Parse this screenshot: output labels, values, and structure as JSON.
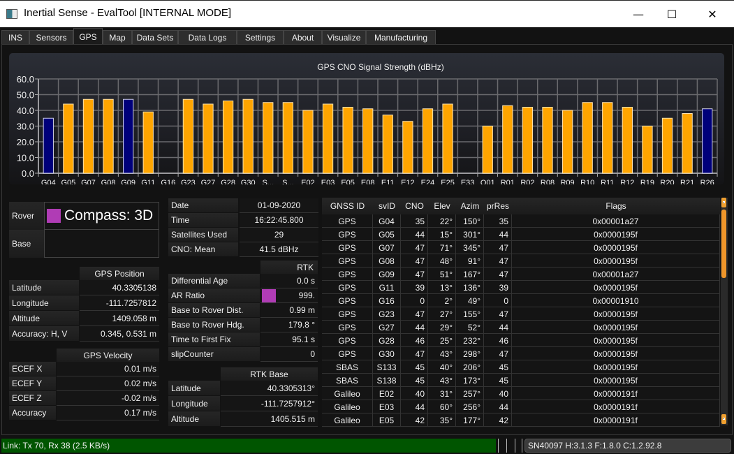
{
  "window": {
    "title": "Inertial Sense - EvalTool [INTERNAL MODE]",
    "minimize_glyph": "—",
    "maximize_glyph": "☐",
    "close_glyph": "✕"
  },
  "tabs": [
    "INS",
    "Sensors",
    "GPS",
    "Map",
    "Data Sets",
    "Data Logs",
    "Settings",
    "About",
    "Visualize",
    "Manufacturing"
  ],
  "active_tab": "GPS",
  "chart_data": {
    "type": "bar",
    "title": "GPS CNO Signal Strength (dBHz)",
    "xlabel": "",
    "ylabel": "",
    "ylim": [
      0,
      60
    ],
    "yticks": [
      "0.0",
      "10.0",
      "20.0",
      "30.0",
      "40.0",
      "50.0",
      "60.0"
    ],
    "grid": true,
    "categories": [
      "G04",
      "G05",
      "G07",
      "G08",
      "G09",
      "G11",
      "G16",
      "G23",
      "G27",
      "G28",
      "G30",
      "S...",
      "S...",
      "E02",
      "E03",
      "E05",
      "E08",
      "E11",
      "E12",
      "E24",
      "E25",
      "E33",
      "Q01",
      "R01",
      "R02",
      "R08",
      "R09",
      "R10",
      "R11",
      "R12",
      "R19",
      "R20",
      "R21",
      "R26"
    ],
    "values": [
      35,
      44,
      47,
      47,
      47,
      39,
      0,
      47,
      44,
      46,
      47,
      45,
      45,
      40,
      44,
      42,
      41,
      37,
      33,
      41,
      44,
      0,
      30,
      43,
      42,
      42,
      40,
      45,
      45,
      42,
      30,
      35,
      38,
      41
    ],
    "highlighted": [
      true,
      false,
      false,
      false,
      true,
      false,
      false,
      false,
      false,
      false,
      false,
      false,
      false,
      false,
      false,
      false,
      false,
      false,
      false,
      false,
      false,
      false,
      false,
      false,
      false,
      false,
      false,
      false,
      false,
      false,
      false,
      false,
      false,
      true
    ],
    "colors": {
      "normal": "#ffa500",
      "highlight": "#00007a"
    }
  },
  "fix": {
    "rover_label": "Rover",
    "rover_value": "Compass: 3D",
    "rover_color": "#b03cb5",
    "base_label": "Base",
    "base_value": ""
  },
  "gps_position": {
    "header": "GPS Position",
    "rows": [
      {
        "label": "Latitude",
        "value": "40.3305138"
      },
      {
        "label": "Longitude",
        "value": "-111.7257812"
      },
      {
        "label": "Altitude",
        "value": "1409.058 m"
      },
      {
        "label": "Accuracy: H, V",
        "value": "0.345, 0.531 m"
      }
    ]
  },
  "gps_velocity": {
    "header": "GPS Velocity",
    "rows": [
      {
        "label": "ECEF X",
        "value": "0.01 m/s"
      },
      {
        "label": "ECEF Y",
        "value": "0.02 m/s"
      },
      {
        "label": "ECEF Z",
        "value": "-0.02 m/s"
      },
      {
        "label": "Accuracy",
        "value": "0.17 m/s"
      }
    ]
  },
  "info": {
    "rows": [
      {
        "label": "Date",
        "value": "01-09-2020"
      },
      {
        "label": "Time",
        "value": "16:22:45.800"
      },
      {
        "label": "Satellites Used",
        "value": "29"
      },
      {
        "label": "CNO: Mean",
        "value": "41.5 dBHz"
      }
    ]
  },
  "rtk": {
    "header": "RTK",
    "ar_color": "#b03cb5",
    "rows": [
      {
        "label": "Differential Age",
        "value": "0.0 s"
      },
      {
        "label": "AR Ratio",
        "value": "999."
      },
      {
        "label": "Base to Rover Dist.",
        "value": "0.99 m"
      },
      {
        "label": "Base to Rover Hdg.",
        "value": "179.8 °"
      },
      {
        "label": "Time to First Fix",
        "value": "95.1 s"
      },
      {
        "label": "slipCounter",
        "value": "0"
      }
    ]
  },
  "rtk_base": {
    "header": "RTK Base",
    "rows": [
      {
        "label": "Latitude",
        "value": "40.3305313°"
      },
      {
        "label": "Longitude",
        "value": "-111.7257912°"
      },
      {
        "label": "Altitude",
        "value": "1405.515 m"
      }
    ]
  },
  "satellites": {
    "columns": [
      "GNSS ID",
      "svID",
      "CNO",
      "Elev",
      "Azim",
      "prRes",
      "Flags"
    ],
    "rows": [
      [
        "GPS",
        "G04",
        "35",
        "22°",
        "150°",
        "35",
        "0x00001a27"
      ],
      [
        "GPS",
        "G05",
        "44",
        "15°",
        "301°",
        "44",
        "0x0000195f"
      ],
      [
        "GPS",
        "G07",
        "47",
        "71°",
        "345°",
        "47",
        "0x0000195f"
      ],
      [
        "GPS",
        "G08",
        "47",
        "48°",
        "91°",
        "47",
        "0x0000195f"
      ],
      [
        "GPS",
        "G09",
        "47",
        "51°",
        "167°",
        "47",
        "0x00001a27"
      ],
      [
        "GPS",
        "G11",
        "39",
        "13°",
        "136°",
        "39",
        "0x0000195f"
      ],
      [
        "GPS",
        "G16",
        "0",
        "2°",
        "49°",
        "0",
        "0x00001910"
      ],
      [
        "GPS",
        "G23",
        "47",
        "27°",
        "155°",
        "47",
        "0x0000195f"
      ],
      [
        "GPS",
        "G27",
        "44",
        "29°",
        "52°",
        "44",
        "0x0000195f"
      ],
      [
        "GPS",
        "G28",
        "46",
        "25°",
        "232°",
        "46",
        "0x0000195f"
      ],
      [
        "GPS",
        "G30",
        "47",
        "43°",
        "298°",
        "47",
        "0x0000195f"
      ],
      [
        "SBAS",
        "S133",
        "45",
        "40°",
        "206°",
        "45",
        "0x0000195f"
      ],
      [
        "SBAS",
        "S138",
        "45",
        "43°",
        "173°",
        "45",
        "0x0000195f"
      ],
      [
        "Galileo",
        "E02",
        "40",
        "31°",
        "257°",
        "40",
        "0x0000191f"
      ],
      [
        "Galileo",
        "E03",
        "44",
        "60°",
        "256°",
        "44",
        "0x0000191f"
      ],
      [
        "Galileo",
        "E05",
        "42",
        "35°",
        "177°",
        "42",
        "0x0000191f"
      ]
    ]
  },
  "status": {
    "link": "Link: Tx 70, Rx 38  (2.5 KB/s)",
    "link_color": "#005500",
    "serial": "SN40097 H:3.1.3  F:1.8.0  C:1.2.92.8"
  }
}
